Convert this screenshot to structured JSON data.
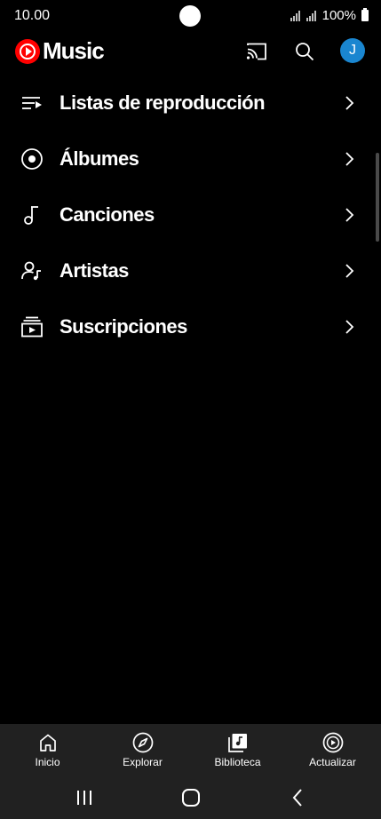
{
  "status": {
    "time": "10.00",
    "battery": "100%"
  },
  "header": {
    "app_name": "Music",
    "avatar_letter": "J",
    "brand_color": "#ff0000",
    "avatar_color": "#1a86d0"
  },
  "library": {
    "items": [
      {
        "label": "Listas de reproducción",
        "icon": "playlist-icon"
      },
      {
        "label": "Álbumes",
        "icon": "album-icon"
      },
      {
        "label": "Canciones",
        "icon": "music-note-icon"
      },
      {
        "label": "Artistas",
        "icon": "artist-icon"
      },
      {
        "label": "Suscripciones",
        "icon": "subscriptions-icon"
      }
    ]
  },
  "bottom_nav": {
    "items": [
      {
        "label": "Inicio",
        "icon": "home-icon"
      },
      {
        "label": "Explorar",
        "icon": "compass-icon"
      },
      {
        "label": "Biblioteca",
        "icon": "library-icon",
        "selected": true
      },
      {
        "label": "Actualizar",
        "icon": "upgrade-icon"
      }
    ]
  },
  "system_nav": {
    "buttons": [
      "recents-icon",
      "home-circle-icon",
      "back-icon"
    ]
  }
}
